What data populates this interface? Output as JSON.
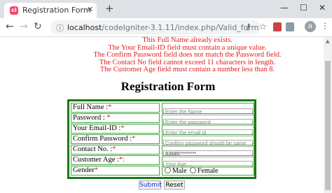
{
  "browser": {
    "tab_title": "Registration Form",
    "tab_favicon": "ci-icon",
    "new_tab": "+",
    "url_host": "localhost",
    "url_path": "/codeIgniter-3.1.11/index.php/Valid_form",
    "avatar_letter": "a"
  },
  "errors": [
    "This Full Name already exists.",
    "The Your Email-ID field must contain a unique value.",
    "The Confirm Password field does not match the Password field.",
    "The Contact No field cannot exceed 11 characters in length.",
    "The Customer Age field must contain a number less than 8."
  ],
  "form": {
    "title": "Registration Form",
    "fields": [
      {
        "label": "Full Name :",
        "required": "*",
        "placeholder": "Enter the Name",
        "value": ""
      },
      {
        "label": "Password : ",
        "required": "*",
        "placeholder": "Enter the password",
        "value": ""
      },
      {
        "label": "Your Email-ID :",
        "required": "*",
        "placeholder": "Enter the email id",
        "value": ""
      },
      {
        "label": "Confirm Password :",
        "required": "*",
        "placeholder": "Confirm password should be same",
        "value": ""
      },
      {
        "label": "Contact No. :",
        "required": "*",
        "placeholder": "",
        "value": "83685********"
      },
      {
        "label": "Customer Age :",
        "required": "*:",
        "placeholder": "Your Age....",
        "value": ""
      }
    ],
    "gender": {
      "label": "Gender",
      "required": "*",
      "options": [
        "Male",
        "Female"
      ]
    },
    "submit_label": "Submit",
    "reset_label": "Reset"
  }
}
